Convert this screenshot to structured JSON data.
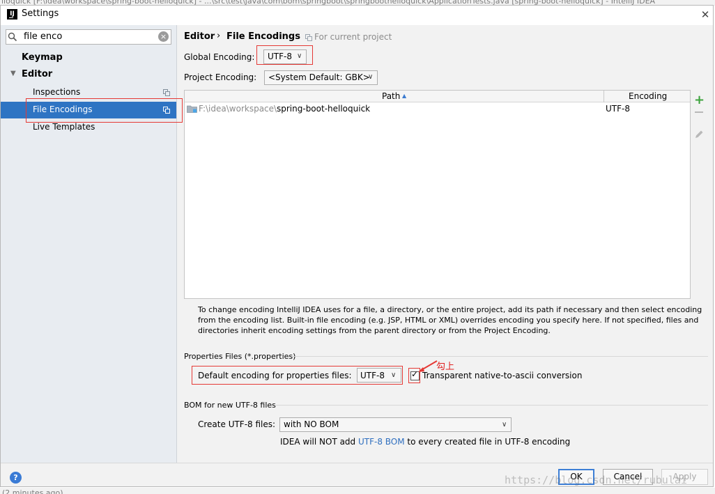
{
  "background": {
    "top_text": "lloquick [F:\\idea\\workspace\\spring-boot-helloquick] - ...\\src\\test\\java\\com\\bom\\springboot\\springboothelloquick\\ApplicationTests.java [spring-boot-helloquick] - IntelliJ IDEA",
    "bottom_text": "(2 minutes ago)"
  },
  "window": {
    "title": "Settings",
    "app_icon": "IJ",
    "close": "✕"
  },
  "search": {
    "value": "file enco",
    "clear": "×"
  },
  "tree": {
    "keymap": "Keymap",
    "editor_arrow": "▼",
    "editor": "Editor",
    "inspections": "Inspections",
    "file_encodings": "File Encodings",
    "live_templates": "Live Templates"
  },
  "breadcrumb": {
    "editor": "Editor",
    "sep": "›",
    "file_encodings": "File Encodings",
    "for_project": "For current project"
  },
  "global": {
    "label": "Global Encoding:",
    "value": "UTF-8"
  },
  "project": {
    "label": "Project Encoding:",
    "value": "<System Default: GBK>"
  },
  "table": {
    "col_path": "Path",
    "sort_icon": "▲",
    "col_encoding": "Encoding",
    "rows": [
      {
        "path_prefix": "F:\\idea\\workspace\\",
        "path_name": "spring-boot-helloquick",
        "encoding": "UTF-8"
      }
    ]
  },
  "side_tools": {
    "add": "+",
    "remove": "−",
    "edit": "edit"
  },
  "help_text": "To change encoding IntelliJ IDEA uses for a file, a directory, or the entire project, add its path if necessary and then select encoding from the encoding list. Built-in file encoding (e.g. JSP, HTML or XML) overrides encoding you specify here. If not specified, files and directories inherit encoding settings from the parent directory or from the Project Encoding.",
  "properties": {
    "header": "Properties Files (*.properties)",
    "default_label": "Default encoding for properties files:",
    "default_value": "UTF-8",
    "checkbox_checked": true,
    "checkbox_mark": "✓",
    "checkbox_label": "Transparent native-to-ascii conversion",
    "annotation": "勾上"
  },
  "bom": {
    "header": "BOM for new UTF-8 files",
    "create_label": "Create UTF-8 files:",
    "create_value": "with NO BOM",
    "note_prefix": "IDEA will NOT add ",
    "note_link": "UTF-8 BOM",
    "note_suffix": " to every created file in UTF-8 encoding"
  },
  "footer": {
    "help": "?",
    "ok": "OK",
    "cancel": "Cancel",
    "apply": "Apply"
  },
  "watermark": "https://blog.csdn.net/rubulai",
  "colors": {
    "selection": "#2e74c3",
    "annotation_red": "#e53935",
    "link": "#2f6fbf",
    "add_green": "#3ca33c"
  }
}
